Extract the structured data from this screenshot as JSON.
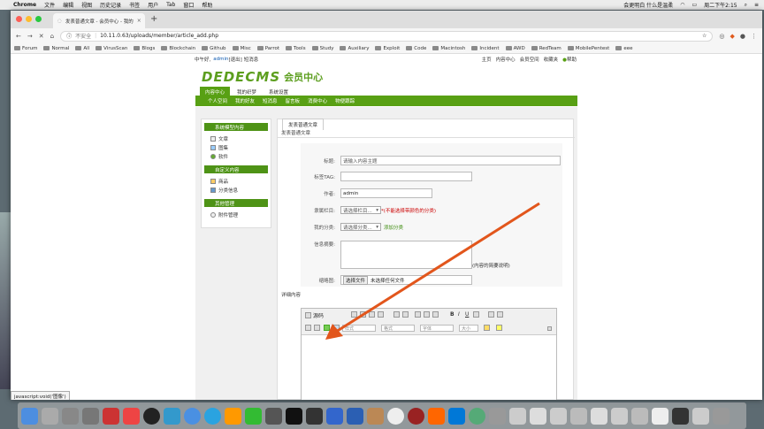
{
  "menubar": {
    "app": "Chrome",
    "items": [
      "文件",
      "编辑",
      "视图",
      "历史记录",
      "书签",
      "用户",
      "Tab",
      "窗口",
      "帮助"
    ],
    "status": "会更明白 什么是温柔",
    "clock": "周二下午2:15"
  },
  "browser": {
    "tab_title": "发表普通文章 - 会员中心 - 我的",
    "insecure_label": "不安全",
    "url": "10.11.0.63/uploads/member/article_add.php",
    "bookmarks": [
      "Forum",
      "Normal",
      "All",
      "VirusScan",
      "Blogs",
      "Blockchain",
      "Github",
      "Misc",
      "Parrot",
      "Tools",
      "Study",
      "Auxiliary",
      "Exploit",
      "Code",
      "Macintosh",
      "Incident",
      "AWD",
      "RedTeam",
      "MobilePentest",
      "eee"
    ]
  },
  "site": {
    "greeting_prefix": "中午好,",
    "user": "admin",
    "logout": "[退出]",
    "messages": "短消息",
    "top_links": [
      "主页",
      "内容中心",
      "会员空间",
      "收藏夹",
      "帮助"
    ],
    "logo_text": "DEDECMS",
    "logo_cn": "会员中心",
    "main_nav": [
      "内容中心",
      "我的织梦",
      "系统设置"
    ],
    "sub_nav": [
      "个人空间",
      "我的好友",
      "短消息",
      "留言板",
      "消费中心",
      "物便跟踪"
    ]
  },
  "sidebar": {
    "sections": [
      {
        "title": "系统模型内容",
        "items": [
          "文章",
          "图集",
          "软件"
        ]
      },
      {
        "title": "自定义内容",
        "items": [
          "商品",
          "分类信息"
        ]
      },
      {
        "title": "其他管理",
        "items": [
          "附件管理"
        ]
      }
    ]
  },
  "form": {
    "tab_label": "发表普通文章",
    "section_title": "发表普通文章",
    "title_label": "标题:",
    "title_placeholder": "请输入内容主题",
    "tag_label": "标签TAG:",
    "author_label": "作者:",
    "author_value": "admin",
    "column_label": "隶属栏目:",
    "column_select": "请选择栏目...",
    "column_hint": "*(不能选择带颜色的分类)",
    "mytype_label": "我的分类:",
    "mytype_select": "请选择分类...",
    "add_type": "添加分类",
    "desc_label": "信息摘要:",
    "desc_hint": "(内容的简要说明)",
    "thumb_label": "缩略图:",
    "choose_file": "选择文件",
    "no_file": "未选择任何文件",
    "detail_label": "详细内容",
    "editor_source": "源码",
    "editor_format": "样式",
    "editor_font": "格式",
    "editor_fontname": "字体",
    "editor_size": "大小"
  },
  "status_tooltip": "javascript:void('图像')",
  "colors": {
    "accent": "#58a014",
    "arrow": "#e2561c"
  }
}
